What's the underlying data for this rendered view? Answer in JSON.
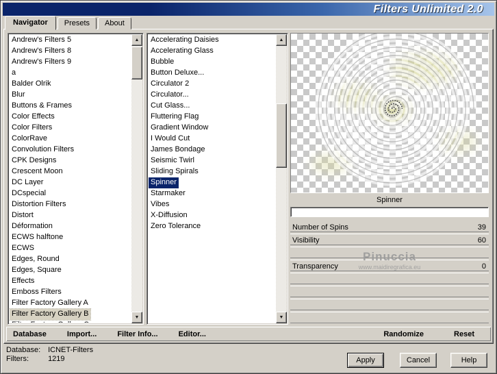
{
  "window": {
    "title": "Filters Unlimited 2.0"
  },
  "tabs": [
    {
      "label": "Navigator",
      "active": true
    },
    {
      "label": "Presets",
      "active": false
    },
    {
      "label": "About",
      "active": false
    }
  ],
  "category_list": {
    "items": [
      "Andrew's Filters 5",
      "Andrew's Filters 8",
      "Andrew's Filters 9",
      "a",
      "Balder Olrik",
      "Blur",
      "Buttons & Frames",
      "Color Effects",
      "Color Filters",
      "ColorRave",
      "Convolution Filters",
      "CPK Designs",
      "Crescent Moon",
      "DC Layer",
      "DCspecial",
      "Distortion Filters",
      "Distort",
      "Déformation",
      "ECWS halftone",
      "ECWS",
      "Edges, Round",
      "Edges, Square",
      "Effects",
      "Emboss Filters",
      "Filter Factory Gallery A",
      "Filter Factory Gallery B",
      "Filter Factory Gallery C"
    ],
    "selected": "Filter Factory Gallery B"
  },
  "filter_list": {
    "items": [
      "Accelerating Daisies",
      "Accelerating Glass",
      "Bubble",
      "Button Deluxe...",
      "Circulator 2",
      "Circulator...",
      "Cut Glass...",
      "Fluttering Flag",
      "Gradient Window",
      "I Would Cut",
      "James Bondage",
      "Seismic Twirl",
      "Sliding Spirals",
      "Spinner",
      "Starmaker",
      "Vibes",
      "X-Diffusion",
      "Zero Tolerance"
    ],
    "selected": "Spinner"
  },
  "preview": {
    "caption": "Spinner",
    "watermark": "Pinuccia",
    "watermark_url": "www.maidiregrafica.eu"
  },
  "parameters": {
    "rows": [
      {
        "label": "Number of Spins",
        "value": "39"
      },
      {
        "label": "Visibility",
        "value": "60"
      },
      {
        "label": "",
        "value": ""
      },
      {
        "label": "Transparency",
        "value": "0"
      },
      {
        "label": "",
        "value": ""
      },
      {
        "label": "",
        "value": ""
      },
      {
        "label": "",
        "value": ""
      },
      {
        "label": "",
        "value": ""
      }
    ]
  },
  "toolbar": {
    "database": "Database",
    "import": "Import...",
    "filter_info": "Filter Info...",
    "editor": "Editor...",
    "randomize": "Randomize",
    "reset": "Reset"
  },
  "status": {
    "database_label": "Database:",
    "database_value": "ICNET-Filters",
    "filters_label": "Filters:",
    "filters_value": "1219"
  },
  "action_buttons": {
    "apply": "Apply",
    "cancel": "Cancel",
    "help": "Help"
  },
  "colors": {
    "titlebar_start": "#0a246a",
    "titlebar_end": "#a6c4ea",
    "selection_blue": "#0a246a",
    "soft_selection": "#d7d2c2",
    "window_bg": "#d4d0c8"
  }
}
